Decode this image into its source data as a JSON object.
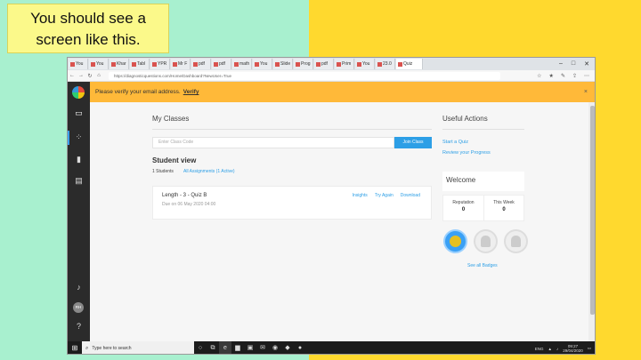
{
  "callout": {
    "line1": "You should see a",
    "line2": "screen like this."
  },
  "browser": {
    "tabs": [
      "You",
      "You",
      "Khar",
      "Tabl",
      "YPR",
      "Mr F",
      "pdf",
      "pdf",
      "math",
      "You",
      "Slide",
      "Prog",
      "pdf",
      "Prim",
      "You",
      "23.0",
      "Quiz"
    ],
    "url": "https://diagnosticquestions.com/Home/Dashboard?NewUser=True",
    "window_controls": [
      "–",
      "□",
      "✕"
    ]
  },
  "banner": {
    "text": "Please verify your email address.",
    "link": "Verify",
    "close": "×"
  },
  "main": {
    "my_classes": "My Classes",
    "class_code_placeholder": "Enter Class Code",
    "join_button": "Join Class",
    "student_view": "Student view",
    "students_count": "1 Students",
    "assignments_link": "All Assignments (1 Active)",
    "quiz": {
      "title": "Length - 3 - Quiz B",
      "due": "Due on 06 May 2020 04:00",
      "actions": [
        "Insights",
        "Try Again",
        "Download"
      ]
    }
  },
  "right": {
    "useful_actions": "Useful Actions",
    "links": [
      "Start a Quiz",
      "Review your Progress"
    ],
    "welcome": "Welcome",
    "stats": [
      {
        "label": "Reputation",
        "value": "0"
      },
      {
        "label": "This Week",
        "value": "0"
      }
    ],
    "see_badges": "See all Badges"
  },
  "sidebar": {
    "avatar_initials": "RH"
  },
  "taskbar": {
    "search_placeholder": "Type here to search",
    "time": "09:27",
    "date": "29/04/2020",
    "lang": "ENG"
  },
  "icons": {
    "sidebar": [
      "presentation-icon",
      "apps-icon",
      "chart-icon",
      "library-icon",
      "bell-icon",
      "help-icon"
    ],
    "accent": "#2d9fe6",
    "banner_color": "#ffb939"
  }
}
